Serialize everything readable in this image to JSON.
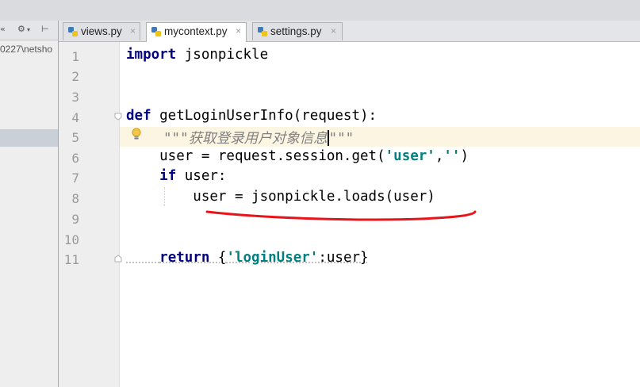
{
  "project_panel": {
    "toolbar_left": "«",
    "toolbar_gear": "⚙",
    "toolbar_pin": "⊢",
    "path_text": "0227\\netsho"
  },
  "tabs": [
    {
      "label": "views.py",
      "close": "×",
      "active": false
    },
    {
      "label": "mycontext.py",
      "close": "×",
      "active": true
    },
    {
      "label": "settings.py",
      "close": "×",
      "active": false
    }
  ],
  "line_numbers": [
    "1",
    "2",
    "3",
    "4",
    "5",
    "6",
    "7",
    "8",
    "9",
    "10",
    "11"
  ],
  "code": {
    "l1": {
      "kw": "import",
      "rest": " jsonpickle"
    },
    "l4": {
      "kw": "def",
      "rest": " getLoginUserInfo(request):"
    },
    "l5": {
      "doc1": "\"\"\"获取登录用户对象信息",
      "doc2": "\"\"\""
    },
    "l6": {
      "pre": "    user = request.session.get(",
      "s1": "'user'",
      "mid": ",",
      "s2": "''",
      "post": ")"
    },
    "l7": {
      "indent": "    ",
      "kw": "if",
      "rest": " user:"
    },
    "l8": {
      "text": "        user = jsonpickle.loads(user)"
    },
    "l11": {
      "indent": "    ",
      "kw": "return",
      "pre": " {",
      "s1": "'loginUser'",
      "post": ":user}"
    }
  },
  "colors": {
    "keyword": "#000080",
    "string": "#008080",
    "docstring": "#808080",
    "annotation": "#e8141b",
    "current_line": "#fbf5e2"
  },
  "icons": {
    "lightbulb": "intention-bulb-icon",
    "python_file": "python-file-icon",
    "fold": "fold-marker-icon"
  }
}
